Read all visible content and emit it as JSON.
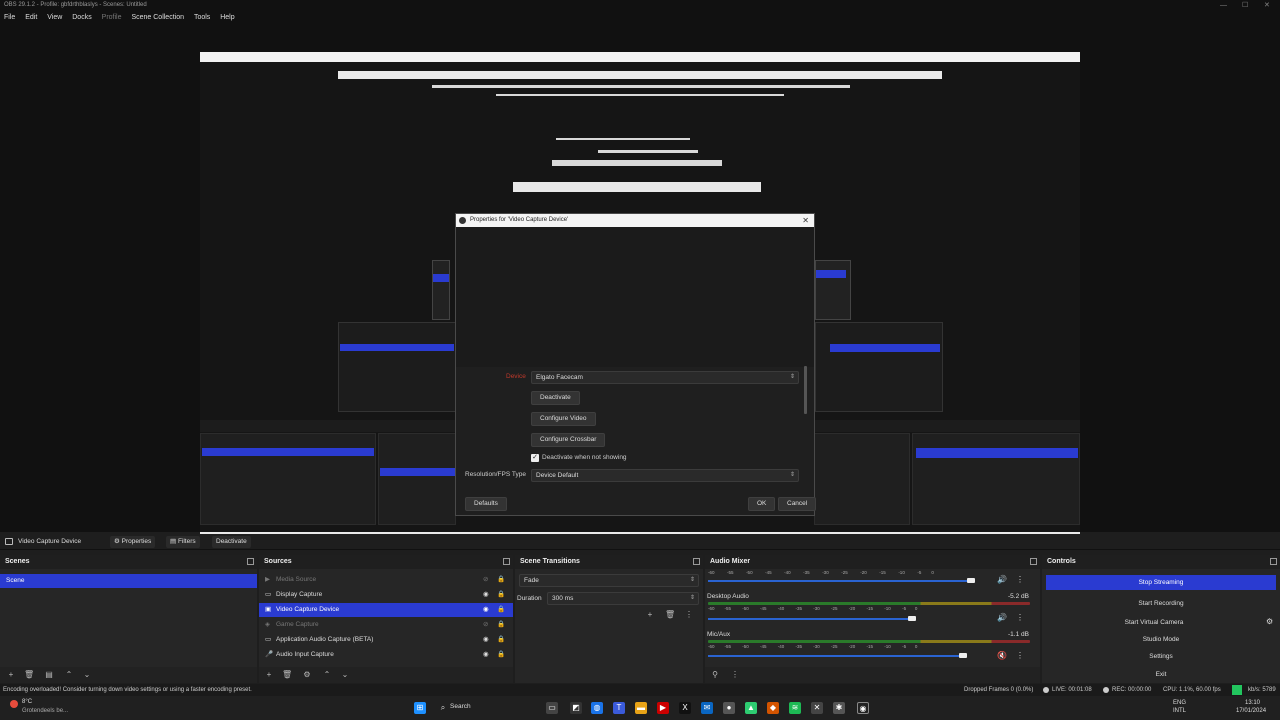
{
  "window": {
    "title": "OBS 29.1.2 - Profile: gbfdrthblaslys - Scenes: Untitled",
    "controls": [
      "—",
      "☐",
      "✕"
    ]
  },
  "menu": [
    "File",
    "Edit",
    "View",
    "Docks",
    "Profile",
    "Scene Collection",
    "Tools",
    "Help"
  ],
  "dialog": {
    "title": "Properties for 'Video Capture Device'",
    "device_label": "Device",
    "device_value": "Elgato Facecam",
    "deactivate": "Deactivate",
    "configure_video": "Configure Video",
    "configure_crossbar": "Configure Crossbar",
    "deactivate_when_not_showing": "Deactivate when not showing",
    "resolution_label": "Resolution/FPS Type",
    "resolution_value": "Device Default",
    "defaults": "Defaults",
    "ok": "OK",
    "cancel": "Cancel"
  },
  "context_bar": {
    "source_name": "Video Capture Device",
    "properties": "Properties",
    "filters": "Filters",
    "deactivate": "Deactivate"
  },
  "scenes": {
    "title": "Scenes",
    "items": [
      "Scene"
    ]
  },
  "sources": {
    "title": "Sources",
    "items": [
      {
        "label": "Media Source",
        "icon": "play-icon",
        "hidden": true
      },
      {
        "label": "Display Capture",
        "icon": "monitor-icon",
        "hidden": false
      },
      {
        "label": "Video Capture Device",
        "icon": "camera-icon",
        "hidden": false,
        "selected": true
      },
      {
        "label": "Game Capture",
        "icon": "gamepad-icon",
        "hidden": true
      },
      {
        "label": "Application Audio Capture (BETA)",
        "icon": "window-icon",
        "hidden": false
      },
      {
        "label": "Audio Input Capture",
        "icon": "mic-icon",
        "hidden": false
      }
    ]
  },
  "transitions": {
    "title": "Scene Transitions",
    "selected": "Fade",
    "duration_label": "Duration",
    "duration_value": "300 ms"
  },
  "mixer": {
    "title": "Audio Mixer",
    "ticks": [
      "-60",
      "-55",
      "-50",
      "-45",
      "-40",
      "-35",
      "-30",
      "-25",
      "-20",
      "-15",
      "-10",
      "-5",
      "0"
    ],
    "channels": [
      {
        "name": "",
        "db": "",
        "level": 0.93
      },
      {
        "name": "Desktop Audio",
        "db": "-5.2 dB",
        "level": 0.72
      },
      {
        "name": "Mic/Aux",
        "db": "-1.1 dB",
        "level": 0.9
      }
    ]
  },
  "controls": {
    "title": "Controls",
    "buttons": [
      "Stop Streaming",
      "Start Recording",
      "Start Virtual Camera",
      "Studio Mode",
      "Settings",
      "Exit"
    ]
  },
  "status": {
    "message": "Encoding overloaded! Consider turning down video settings or using a faster encoding preset.",
    "dropped": "Dropped Frames 0 (0.0%)",
    "live": "LIVE: 00:01:08",
    "rec": "REC: 00:00:00",
    "cpu": "CPU: 1.1%, 60.00 fps",
    "kbs": "kb/s: 5789"
  },
  "taskbar": {
    "weather_temp": "8°C",
    "weather_text": "Grotendeels be...",
    "search": "Search",
    "lang": "ENG",
    "region": "INTL",
    "time": "13:10",
    "date": "17/01/2024"
  },
  "colors": {
    "accent": "#2a3bd1",
    "panel": "#262626",
    "background": "#1e1e1e",
    "live_indicator": "#22c55e"
  }
}
